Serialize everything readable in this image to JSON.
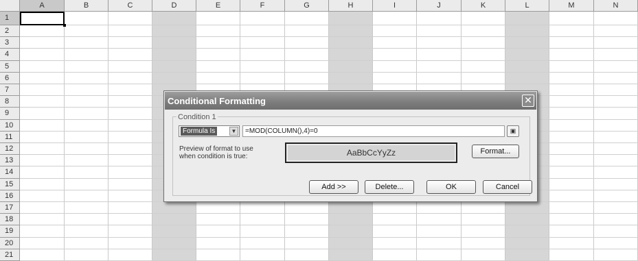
{
  "spreadsheet": {
    "columns": [
      "A",
      "B",
      "C",
      "D",
      "E",
      "F",
      "G",
      "H",
      "I",
      "J",
      "K",
      "L",
      "M",
      "N"
    ],
    "rows": [
      "1",
      "2",
      "3",
      "4",
      "5",
      "6",
      "7",
      "8",
      "9",
      "10",
      "11",
      "12",
      "13",
      "14",
      "15",
      "16",
      "17",
      "18",
      "19",
      "20",
      "21"
    ],
    "active_cell": "A1",
    "shaded_columns": [
      "D",
      "H",
      "L"
    ],
    "shade_color": "#d6d6d6"
  },
  "dialog": {
    "title": "Conditional Formatting",
    "close_icon": "close-icon",
    "condition_label": "Condition 1",
    "condition_type": "Formula Is",
    "formula": "=MOD(COLUMN(),4)=0",
    "ref_icon": "collapse-dialog-icon",
    "preview_label_line1": "Preview of format to use",
    "preview_label_line2": "when condition is true:",
    "preview_text": "AaBbCcYyZz",
    "format_button": "Format...",
    "add_button": "Add >>",
    "delete_button": "Delete...",
    "ok_button": "OK",
    "cancel_button": "Cancel"
  }
}
